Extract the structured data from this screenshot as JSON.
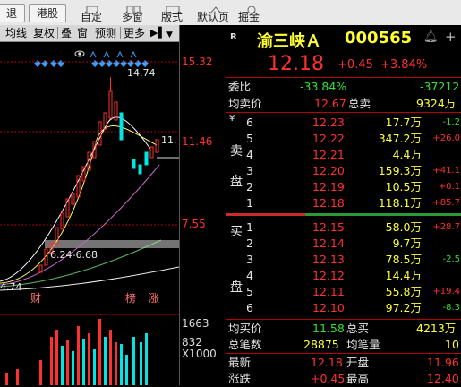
{
  "toolbar": {
    "btn1": "退",
    "btn2": "港股",
    "items": [
      "自定",
      "多窗",
      "版式",
      "默认页",
      "掘金"
    ]
  },
  "chart_tabs": [
    "均线",
    "复权",
    "叠",
    "窗",
    "预测",
    "更多"
  ],
  "chart": {
    "high_label": "14.74",
    "range_label": "6.24-6.68",
    "low_label": "4.74",
    "event_labels": [
      "财",
      "榜",
      "涨"
    ],
    "ma_tag": "11."
  },
  "axis": {
    "top": "15.32",
    "mid": "11.46",
    "low": "7.55",
    "vol1": "1663",
    "vol2": "832",
    "vol_unit": "X1000"
  },
  "quote": {
    "badge": "R",
    "name": "渝三峡Ａ",
    "code": "000565",
    "price": "12.18",
    "change": "+0.45",
    "change_pct": "+3.84%",
    "weibi_label": "委比",
    "weibi_val": "-33.84%",
    "weibi_diff": "-37212",
    "avg_sell_label": "均卖价",
    "avg_sell_val": "12.67",
    "total_sell_label": "总卖",
    "total_sell_val": "9324万",
    "sell_label_chars": [
      "卖",
      "盘"
    ],
    "buy_label_chars": [
      "买",
      "盘"
    ],
    "asks": [
      {
        "lvl": "6",
        "price": "12.23",
        "vol": "17.7万",
        "chg": "-1.2"
      },
      {
        "lvl": "5",
        "price": "12.22",
        "vol": "347.2万",
        "chg": "+26.0"
      },
      {
        "lvl": "4",
        "price": "12.21",
        "vol": "4.4万",
        "chg": ""
      },
      {
        "lvl": "3",
        "price": "12.20",
        "vol": "159.3万",
        "chg": "+41.1"
      },
      {
        "lvl": "2",
        "price": "12.19",
        "vol": "10.5万",
        "chg": "+0.1"
      },
      {
        "lvl": "1",
        "price": "12.18",
        "vol": "118.1万",
        "chg": "+85.7"
      }
    ],
    "bids": [
      {
        "lvl": "1",
        "price": "12.15",
        "vol": "58.0万",
        "chg": "+28.7"
      },
      {
        "lvl": "2",
        "price": "12.14",
        "vol": "9.7万",
        "chg": ""
      },
      {
        "lvl": "3",
        "price": "12.13",
        "vol": "78.5万",
        "chg": "-2.5"
      },
      {
        "lvl": "4",
        "price": "12.12",
        "vol": "14.4万",
        "chg": ""
      },
      {
        "lvl": "5",
        "price": "12.11",
        "vol": "55.8万",
        "chg": "+19.4"
      },
      {
        "lvl": "6",
        "price": "12.10",
        "vol": "97.2万",
        "chg": "-8.3"
      }
    ],
    "avg_buy_label": "均买价",
    "avg_buy_val": "11.58",
    "total_buy_label": "总买",
    "total_buy_val": "4213万",
    "total_trades_label": "总笔数",
    "total_trades_val": "28875",
    "avg_vol_label": "均笔量",
    "avg_vol_val": "10",
    "last_label": "最新",
    "last_val": "12.18",
    "open_label": "开盘",
    "open_val": "11.96",
    "chg_label": "涨跌",
    "chg_val": "+0.45",
    "high_label": "最高",
    "high_val": "12.40"
  },
  "colors": {
    "up": "#ff3030",
    "down": "#33e033",
    "accent": "#ffff33",
    "cyan": "#00e5e5"
  }
}
